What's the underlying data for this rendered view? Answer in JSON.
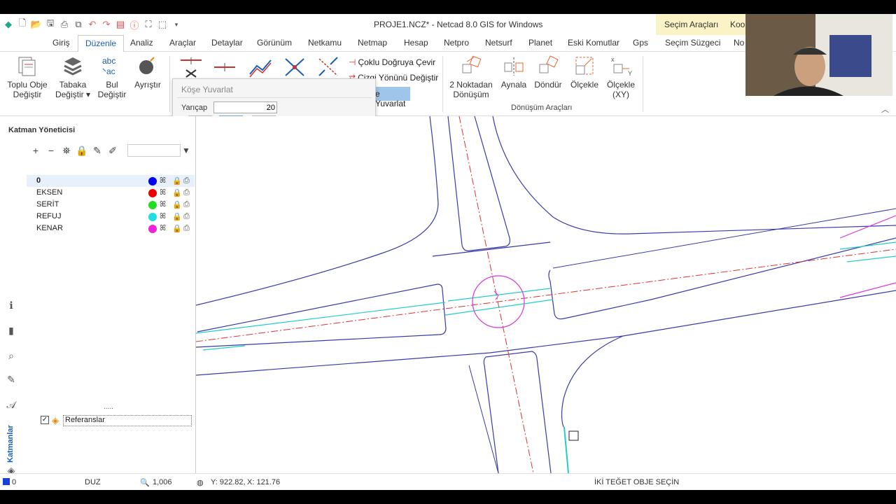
{
  "titlebar": {
    "title": "PROJE1.NCZ* - Netcad 8.0 GIS for Windows",
    "context_tabs": [
      "Seçim Araçları",
      "Koo"
    ]
  },
  "tabs": [
    "Giriş",
    "Düzenle",
    "Analiz",
    "Araçlar",
    "Detaylar",
    "Görünüm",
    "Netkamu",
    "Netmap",
    "Hesap",
    "Netpro",
    "Netsurf",
    "Planet",
    "Eski Komutlar",
    "Gps",
    "Seçim Süzgeci",
    "No"
  ],
  "active_tab": "Düzenle",
  "ribbon": {
    "toplu": "Toplu Obje\nDeğiştir",
    "tabaka": "Tabaka\nDeğiştir ▾",
    "bul": "Bul\nDeğiştir",
    "ayristir": "Ayrıştır",
    "coklu": "Çoklu Doğruya Çevir",
    "cizgi": "Çizgi Yönünü Değiştir",
    "kose": "e Yuvarlat",
    "noktadan": "2 Noktadan\nDönüşüm",
    "aynala": "Aynala",
    "dondur": "Döndür",
    "olcekle": "Ölçekle",
    "olcekle_xy": "Ölçekle\n(XY)",
    "group_donusum": "Dönüşüm Araçları"
  },
  "popup": {
    "title": "Köşe Yuvarlat",
    "radius_label": "Yarıçap",
    "radius_value": "20"
  },
  "panel": {
    "title": "Katman Yöneticisi",
    "layers": [
      {
        "name": "0",
        "color": "#0000ee"
      },
      {
        "name": "EKSEN",
        "color": "#ee0000"
      },
      {
        "name": "SERİT",
        "color": "#22dd22"
      },
      {
        "name": "REFUJ",
        "color": "#22dddd"
      },
      {
        "name": "KENAR",
        "color": "#ee22dd"
      }
    ],
    "references": "Referanslar",
    "vertical_tab": "Katmanlar"
  },
  "status": {
    "layer": "0",
    "mode": "DUZ",
    "zoom": "1,006",
    "coords_y": "Y: 922.82,",
    "coords_x": "X: 121.76",
    "message": "İKİ TEĞET OBJE SEÇİN"
  }
}
